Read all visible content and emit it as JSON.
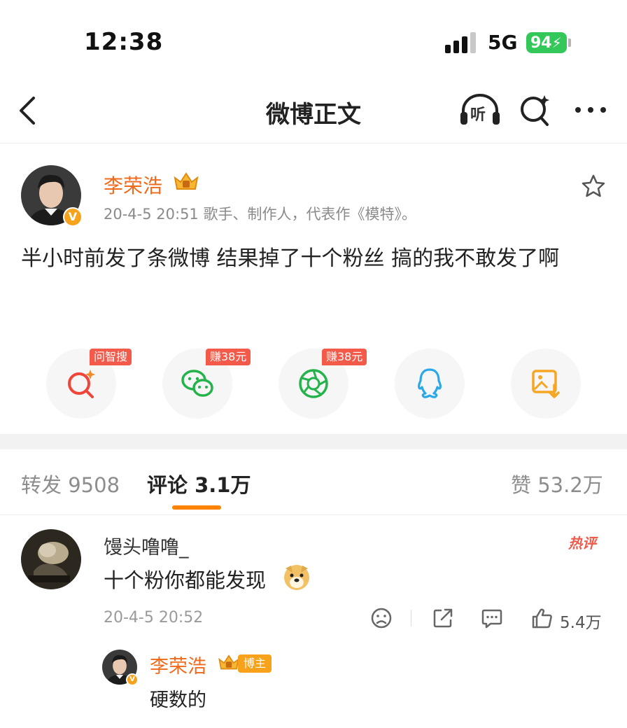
{
  "status_bar": {
    "time": "12:38",
    "network": "5G",
    "battery": "94"
  },
  "nav": {
    "title": "微博正文",
    "listen_label": "听"
  },
  "post": {
    "author": "李荣浩",
    "verified_badge": "V",
    "meta": "20-4-5 20:51  歌手、制作人，代表作《模特》。",
    "text": "半小时前发了条微博 结果掉了十个粉丝 搞的我不敢发了啊"
  },
  "share": {
    "tags": [
      "问智搜",
      "赚38元",
      "赚38元"
    ],
    "icons": [
      "zhisou-search-icon",
      "wechat-icon",
      "moments-icon",
      "qq-icon",
      "save-image-icon"
    ]
  },
  "tabs": {
    "repost": "转发 9508",
    "comment": "评论 3.1万",
    "like": "赞 53.2万"
  },
  "comment": {
    "user": "馒头噜噜_",
    "hot_label": "热评",
    "text": "十个粉你都能发现",
    "emoji": "doge-emoji",
    "time": "20-4-5 20:52",
    "like_count": "5.4万"
  },
  "reply": {
    "user": "李荣浩",
    "badge": "博主",
    "text": "硬数的"
  },
  "colors": {
    "accent": "#ff8200",
    "name_orange": "#f06a1c",
    "tag_red": "#f35a4a",
    "battery_green": "#34c759"
  }
}
